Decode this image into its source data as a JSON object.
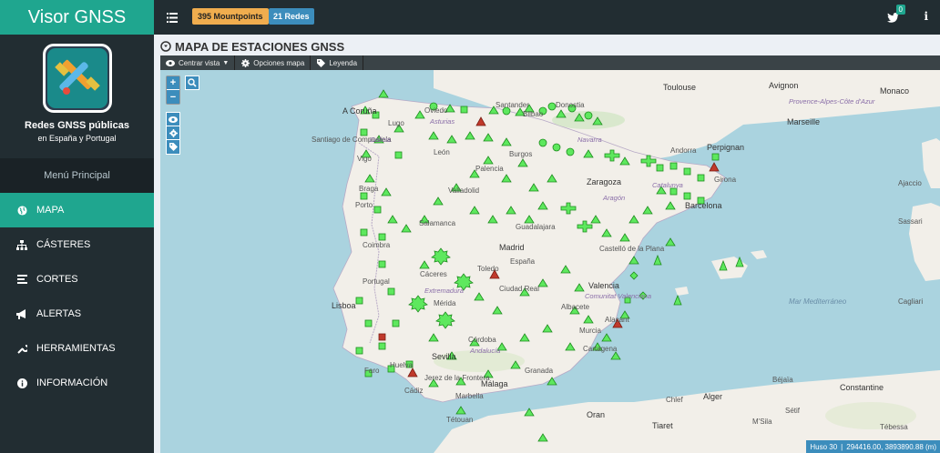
{
  "sidebar": {
    "brand": "Visor GNSS",
    "panel_title": "Redes GNSS públicas",
    "panel_subtitle": "en España y Portugal",
    "menu_header": "Menú Principal",
    "items": [
      {
        "label": "MAPA",
        "icon": "globe-icon",
        "active": true
      },
      {
        "label": "CÁSTERES",
        "icon": "sitemap-icon",
        "active": false
      },
      {
        "label": "CORTES",
        "icon": "list-icon",
        "active": false
      },
      {
        "label": "ALERTAS",
        "icon": "bullhorn-icon",
        "active": false
      },
      {
        "label": "HERRAMIENTAS",
        "icon": "wrench-icon",
        "active": false
      },
      {
        "label": "INFORMACIÓN",
        "icon": "info-circle-icon",
        "active": false
      }
    ]
  },
  "header": {
    "mountpoints_badge": "395 Mountpoints",
    "redes_badge": "21 Redes",
    "twitter_count": "0"
  },
  "content": {
    "title": "MAPA DE ESTACIONES GNSS",
    "toolbar": {
      "center_label": "Centrar vista",
      "options_label": "Opciones mapa",
      "legend_label": "Leyenda"
    }
  },
  "map": {
    "coords_zone": "Huso 30",
    "coords_value": "294416.00, 3893890.88 (m)",
    "labels": {
      "toulouse": "Toulouse",
      "avignon": "Avignon",
      "monaco": "Monaco",
      "marseille": "Marseille",
      "cote_azur": "Provence-Alpes-Côte d'Azur",
      "perpignan": "Perpignan",
      "andorra": "Andorra",
      "ajaccio": "Ajaccio",
      "sassari": "Sassari",
      "cagliari": "Cagliari",
      "coruna": "A Coruña",
      "santiago": "Santiago de Compostela",
      "galicia": "Galicia",
      "lugo": "Lugo",
      "vigo": "Vigo",
      "oviedo": "Oviedo",
      "asturias": "Asturias",
      "santander": "Santander",
      "bilbao": "Bilbao",
      "donostia": "Donostia",
      "navarra": "Navarra",
      "burgos": "Burgos",
      "palencia": "Palencia",
      "leon": "León",
      "braga": "Braga",
      "porto": "Porto",
      "valladolid": "Valladolid",
      "zaragoza": "Zaragoza",
      "aragon": "Aragón",
      "girona": "Girona",
      "catalunya": "Catalunya",
      "barcelona": "Barcelona",
      "salamanca": "Salamanca",
      "guadalajara": "Guadalajara",
      "madrid": "Madrid",
      "coimbra": "Coimbra",
      "espana": "España",
      "portugal": "Portugal",
      "castellon": "Castelló de la Plana",
      "valencia": "Valencia",
      "com_valenciana": "Comunitat Valenciana",
      "caceres": "Cáceres",
      "extremadura": "Extremadura",
      "toledo": "Toledo",
      "ciudad_real": "Ciudad Real",
      "albacete": "Albacete",
      "lisboa": "Lisboa",
      "merida": "Mérida",
      "alicante": "Alacant",
      "murcia": "Murcia",
      "cordoba": "Córdoba",
      "andalucia": "Andalucía",
      "sevilla": "Sevilla",
      "huelva": "Huelva",
      "jerez": "Jerez de la Frontera",
      "cadiz": "Cádiz",
      "malaga": "Málaga",
      "marbella": "Marbella",
      "granada": "Granada",
      "cartagena": "Cartagena",
      "faro": "Faro",
      "tetouan": "Tétouan",
      "oran": "Oran",
      "tiaret": "Tiaret",
      "chlef": "Chlef",
      "alger": "Alger",
      "constantine": "Constantine",
      "setif": "Sétif",
      "msila": "M'Sila",
      "bejaia": "Béjaïa",
      "tebessa": "Tébessa",
      "mallorca_sea": "Mar Mediterráneo"
    }
  }
}
